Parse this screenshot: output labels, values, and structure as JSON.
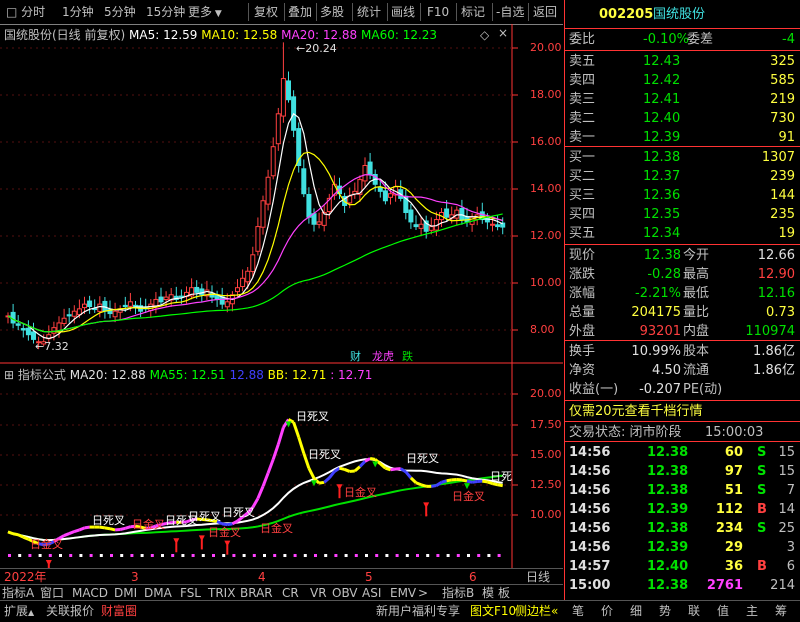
{
  "toolbar": {
    "periods": [
      "分时",
      "1分钟",
      "5分钟",
      "15分钟",
      "更多"
    ],
    "right_buttons": [
      "复权",
      "叠加",
      "多股",
      "统计",
      "画线",
      "F10",
      "标记",
      "-自选",
      "返回"
    ]
  },
  "main_legend": {
    "title": "国统股份(日线 前复权)",
    "ma5": "MA5: 12.59",
    "ma10": "MA10: 12.58",
    "ma20": "MA20: 12.88",
    "ma60": "MA60: 12.23"
  },
  "main_axis": [
    "20.00",
    "18.00",
    "16.00",
    "14.00",
    "12.00",
    "10.00",
    "8.00"
  ],
  "main_annotations": {
    "high": "20.24",
    "low": "7.32"
  },
  "main_badges": [
    "财",
    "龙虎",
    "跌"
  ],
  "sub_legend": {
    "name": "指标公式",
    "ma20": "MA20: 12.88",
    "ma55": "MA55: 12.51",
    "v3": "12.88",
    "bb": "BB: 12.71",
    "v5": ": 12.71"
  },
  "sub_axis": [
    "20.00",
    "17.50",
    "15.00",
    "12.50",
    "10.00"
  ],
  "sub_signals": {
    "golden": "日金叉",
    "dead": "日死叉",
    "dead_partial": "日死"
  },
  "date_axis": {
    "labels": [
      "2022年",
      "3",
      "4",
      "5",
      "6"
    ],
    "period": "日线"
  },
  "indicator_tabs": [
    "指标A",
    "窗口",
    "MACD",
    "DMI",
    "DMA",
    "FSL",
    "TRIX",
    "BRAR",
    "CR",
    "VR",
    "OBV",
    "ASI",
    "EMV"
  ],
  "indicator_tabs_right": [
    "指标B",
    "模",
    "板"
  ],
  "bar2": [
    "扩展",
    "关联报价",
    "财富圈"
  ],
  "bar3_center": [
    "新用户福利专享",
    "图文F10",
    "侧边栏"
  ],
  "bar3_right": [
    "笔",
    "价",
    "细",
    "势",
    "联",
    "值",
    "主",
    "筹"
  ],
  "stock": {
    "code": "002205",
    "name": "国统股份"
  },
  "order_book": {
    "webi_label": "委比",
    "webi": "-0.10%",
    "weicha_label": "委差",
    "weicha": "-4",
    "asks": [
      {
        "label": "卖五",
        "price": "12.43",
        "vol": "325"
      },
      {
        "label": "卖四",
        "price": "12.42",
        "vol": "585"
      },
      {
        "label": "卖三",
        "price": "12.41",
        "vol": "219"
      },
      {
        "label": "卖二",
        "price": "12.40",
        "vol": "730"
      },
      {
        "label": "卖一",
        "price": "12.39",
        "vol": "91"
      }
    ],
    "bids": [
      {
        "label": "买一",
        "price": "12.38",
        "vol": "1307"
      },
      {
        "label": "买二",
        "price": "12.37",
        "vol": "239"
      },
      {
        "label": "买三",
        "price": "12.36",
        "vol": "144"
      },
      {
        "label": "买四",
        "price": "12.35",
        "vol": "235"
      },
      {
        "label": "买五",
        "price": "12.34",
        "vol": "19"
      }
    ]
  },
  "quote": [
    {
      "l1": "现价",
      "v1": "12.38",
      "c1": "green",
      "l2": "今开",
      "v2": "12.66",
      "c2": "white"
    },
    {
      "l1": "涨跌",
      "v1": "-0.28",
      "c1": "green",
      "l2": "最高",
      "v2": "12.90",
      "c2": "red"
    },
    {
      "l1": "涨幅",
      "v1": "-2.21%",
      "c1": "green",
      "l2": "最低",
      "v2": "12.16",
      "c2": "green"
    },
    {
      "l1": "总量",
      "v1": "204175",
      "c1": "yellow",
      "l2": "量比",
      "v2": "0.73",
      "c2": "yellow"
    },
    {
      "l1": "外盘",
      "v1": "93201",
      "c1": "red",
      "l2": "内盘",
      "v2": "110974",
      "c2": "green"
    }
  ],
  "fundamentals": [
    {
      "l1": "换手",
      "v1": "10.99%",
      "l2": "股本",
      "v2": "1.86亿"
    },
    {
      "l1": "净资",
      "v1": "4.50",
      "l2": "流通",
      "v2": "1.86亿"
    },
    {
      "l1": "收益(一)",
      "v1": "-0.207",
      "l2": "PE(动)",
      "v2": ""
    }
  ],
  "promo": "仅需20元查看千档行情",
  "trade_status": {
    "label": "交易状态: 闭市阶段",
    "time": "15:00:03"
  },
  "ticks": [
    {
      "t": "14:56",
      "p": "12.38",
      "v": "60",
      "s": "S",
      "n": "15"
    },
    {
      "t": "14:56",
      "p": "12.38",
      "v": "97",
      "s": "S",
      "n": "15"
    },
    {
      "t": "14:56",
      "p": "12.38",
      "v": "51",
      "s": "S",
      "n": "7"
    },
    {
      "t": "14:56",
      "p": "12.39",
      "v": "112",
      "s": "B",
      "n": "14"
    },
    {
      "t": "14:56",
      "p": "12.38",
      "v": "234",
      "s": "S",
      "n": "25"
    },
    {
      "t": "14:56",
      "p": "12.39",
      "v": "29",
      "s": "",
      "n": "3"
    },
    {
      "t": "14:57",
      "p": "12.40",
      "v": "36",
      "s": "B",
      "n": "6"
    },
    {
      "t": "15:00",
      "p": "12.38",
      "v": "2761",
      "s": "",
      "n": "214"
    }
  ],
  "colors": {
    "up": "#ff4040",
    "down": "#00e0e0",
    "ma5": "#ffffff",
    "ma10": "#ffff00",
    "ma20": "#ff40ff",
    "ma60": "#00ff00",
    "axis": "#ff3333"
  }
}
